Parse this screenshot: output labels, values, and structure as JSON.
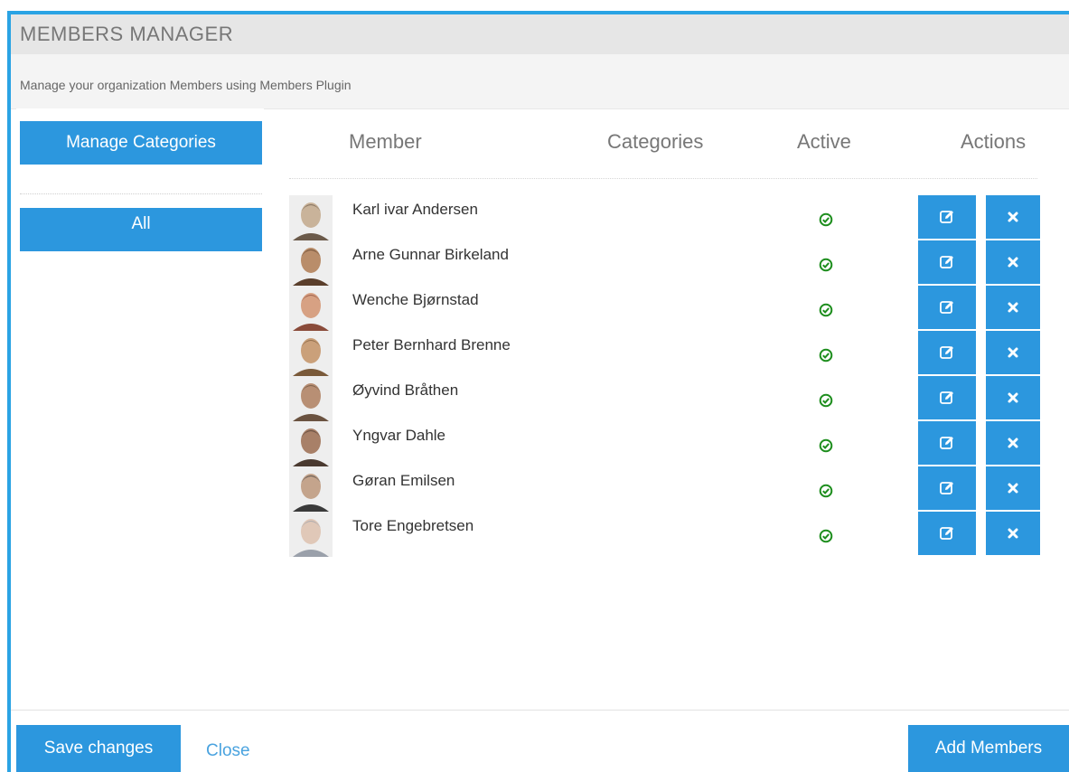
{
  "header": {
    "title": "MEMBERS MANAGER",
    "subtitle": "Manage your organization Members using Members Plugin"
  },
  "sidebar": {
    "manage_categories_label": "Manage Categories",
    "categories": [
      {
        "label": "All",
        "selected": true
      }
    ]
  },
  "table": {
    "columns": {
      "member": "Member",
      "categories": "Categories",
      "active": "Active",
      "actions": "Actions"
    },
    "rows": [
      {
        "name": "Karl ivar Andersen",
        "categories": "",
        "active": true
      },
      {
        "name": "Arne Gunnar Birkeland",
        "categories": "",
        "active": true
      },
      {
        "name": "Wenche Bjørnstad",
        "categories": "",
        "active": true
      },
      {
        "name": "Peter Bernhard Brenne",
        "categories": "",
        "active": true
      },
      {
        "name": "Øyvind Bråthen",
        "categories": "",
        "active": true
      },
      {
        "name": "Yngvar Dahle",
        "categories": "",
        "active": true
      },
      {
        "name": "Gøran Emilsen",
        "categories": "",
        "active": true
      },
      {
        "name": "Tore Engebretsen",
        "categories": "",
        "active": true
      }
    ],
    "row_icons": {
      "active": "check-circle-icon",
      "edit": "edit-icon",
      "delete": "close-icon"
    }
  },
  "footer": {
    "save_label": "Save changes",
    "close_label": "Close",
    "add_label": "Add Members"
  },
  "colors": {
    "accent": "#2c97de",
    "frame": "#2aa3e4",
    "active_green": "#1e8e1e",
    "link": "#4aa3df"
  }
}
